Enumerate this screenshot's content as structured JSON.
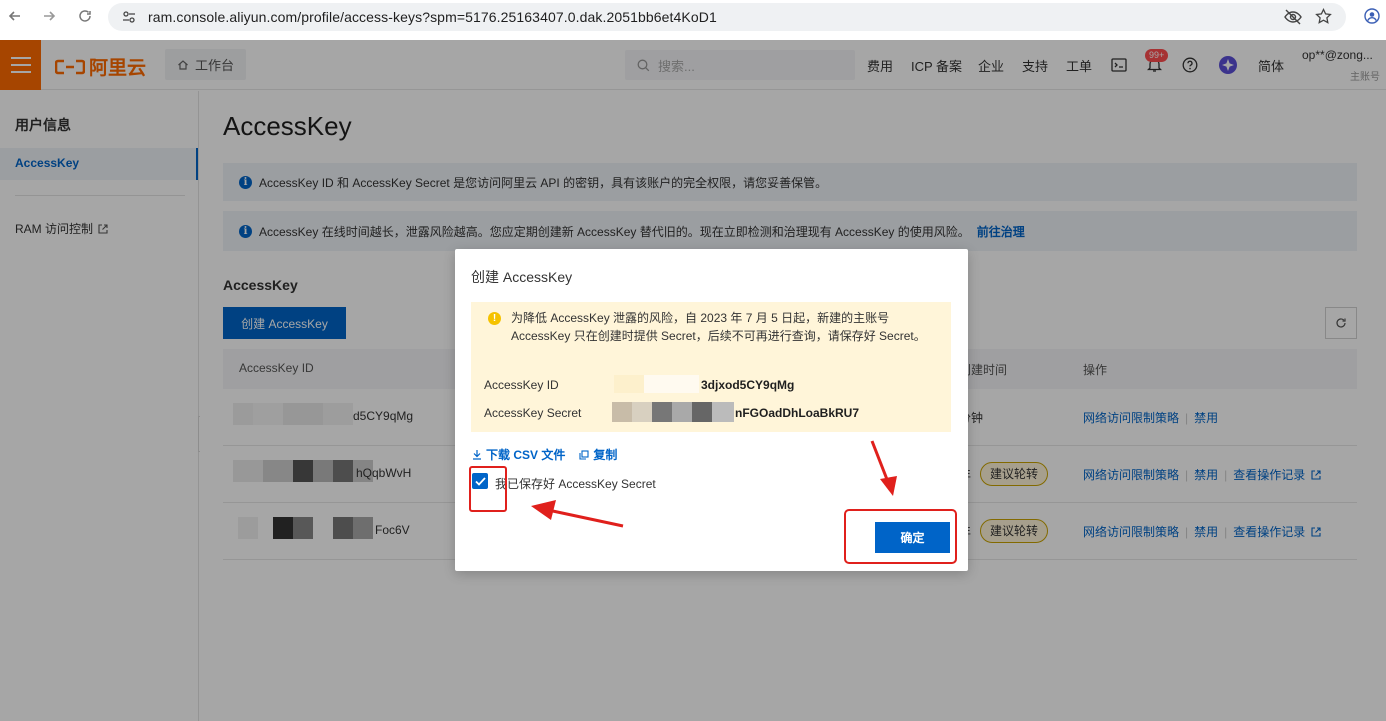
{
  "browser": {
    "url": "ram.console.aliyun.com/profile/access-keys?spm=5176.25163407.0.dak.2051bb6et4KoD1"
  },
  "topbar": {
    "logo_text": "阿里云",
    "workbench_label": "工作台",
    "search_placeholder": "搜索...",
    "nav": [
      "费用",
      "ICP 备案",
      "企业",
      "支持",
      "工单"
    ],
    "notification_badge": "99+",
    "lang_label": "简体",
    "account_name": "op**@zong...",
    "account_type": "主账号",
    "accent_color": "#ff6a00"
  },
  "sidebar": {
    "title": "用户信息",
    "active_item": "AccessKey",
    "ram_item": "RAM 访问控制"
  },
  "main": {
    "page_title": "AccessKey",
    "notice1": "AccessKey ID 和 AccessKey Secret 是您访问阿里云 API 的密钥，具有该账户的完全权限，请您妥善保管。",
    "notice2": "AccessKey 在线时间越长，泄露风险越高。您应定期创建新 AccessKey 替代旧的。现在立即检测和治理现有 AccessKey 的使用风险。",
    "notice2_link": "前往治理",
    "section_title": "AccessKey",
    "create_button": "创建 AccessKey",
    "table": {
      "col_id": "AccessKey ID",
      "col_created": "创建时间",
      "col_ops": "操作",
      "rows": [
        {
          "id_suffix": "d5CY9qMg",
          "created": "分钟",
          "tag": "",
          "ops": [
            "网络访问限制策略",
            "禁用"
          ]
        },
        {
          "id_suffix": "hQqbWvH",
          "created": "年",
          "tag": "建议轮转",
          "ops": [
            "网络访问限制策略",
            "禁用",
            "查看操作记录"
          ]
        },
        {
          "id_suffix": "Foc6V",
          "created": "年",
          "tag": "建议轮转",
          "ops": [
            "网络访问限制策略",
            "禁用",
            "查看操作记录"
          ]
        }
      ]
    }
  },
  "modal": {
    "title": "创建 AccessKey",
    "warning": "为降低 AccessKey 泄露的风险，自 2023 年 7 月 5 日起，新建的主账号 AccessKey 只在创建时提供 Secret，后续不可再进行查询，请保存好 Secret。",
    "id_label": "AccessKey ID",
    "id_value": "3djxod5CY9qMg",
    "secret_label": "AccessKey Secret",
    "secret_value": "nFGOadDhLoaBkRU7",
    "download_label": "下载 CSV 文件",
    "copy_label": "复制",
    "checkbox_label": "我已保存好 AccessKey Secret",
    "checkbox_checked": true,
    "confirm_button": "确定"
  },
  "colors": {
    "primary": "#0064c8",
    "annotation_red": "#e0201c",
    "warning_bg": "#fff5d9"
  }
}
